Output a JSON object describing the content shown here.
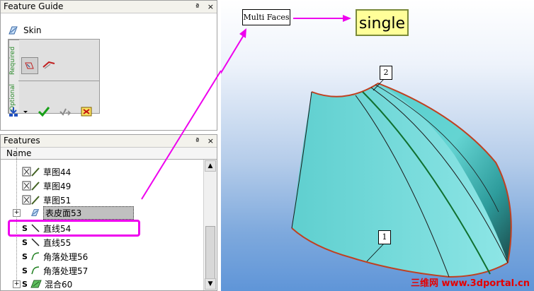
{
  "feature_guide": {
    "title": "Feature Guide",
    "pin": "ª",
    "close": "×",
    "skin_label": "Skin",
    "required_label": "Required",
    "optional_label": "Optional"
  },
  "features": {
    "title": "Features",
    "pin": "ª",
    "close": "×",
    "column_header": "Name",
    "items": [
      {
        "label": "草图44"
      },
      {
        "label": "草图49"
      },
      {
        "label": "草图51"
      },
      {
        "label": "表皮面53",
        "expander": "+"
      },
      {
        "label": "直线54"
      },
      {
        "label": "直线55"
      },
      {
        "label": "角落处理56"
      },
      {
        "label": "角落处理57"
      },
      {
        "label": "混合60",
        "expander": "+"
      }
    ]
  },
  "viewport": {
    "callout_multi_faces": "Multi Faces",
    "callout_single": "single",
    "label_1": "1",
    "label_2": "2",
    "watermark": "三维网 www.3dportal.cn"
  },
  "colors": {
    "annotation": "#ee00ee",
    "surface": "#40b8b8",
    "edge": "#c04020",
    "background_blue": "#6a9bd8"
  }
}
